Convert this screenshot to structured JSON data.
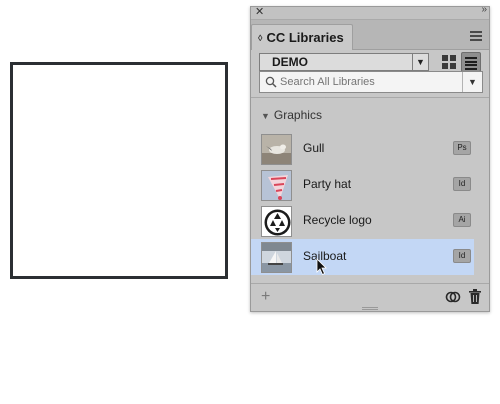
{
  "panel": {
    "tab_label": "CC Libraries",
    "library": {
      "selected": "DEMO"
    },
    "search": {
      "placeholder": "Search All Libraries",
      "value": ""
    },
    "section": {
      "label": "Graphics"
    },
    "assets": [
      {
        "label": "Gull",
        "badge": "Ps",
        "thumb": "gull-thumbnail"
      },
      {
        "label": "Party hat",
        "badge": "Id",
        "thumb": "party-hat-thumbnail"
      },
      {
        "label": "Recycle logo",
        "badge": "Ai",
        "thumb": "recycle-logo-thumbnail"
      },
      {
        "label": "Sailboat",
        "badge": "Id",
        "thumb": "sailboat-thumbnail",
        "selected": true
      }
    ]
  },
  "icons": [
    "close-icon",
    "collapse-icon",
    "panel-menu-icon",
    "dropdown-arrow-icon",
    "grid-view-icon",
    "list-view-icon",
    "search-icon",
    "add-icon",
    "creative-cloud-sync-icon",
    "trash-icon",
    "mouse-cursor-icon"
  ],
  "colors": {
    "panel_bg": "#c7c7c7",
    "selected_row": "#c3d7f5",
    "canvas_border": "#2b2f33"
  }
}
